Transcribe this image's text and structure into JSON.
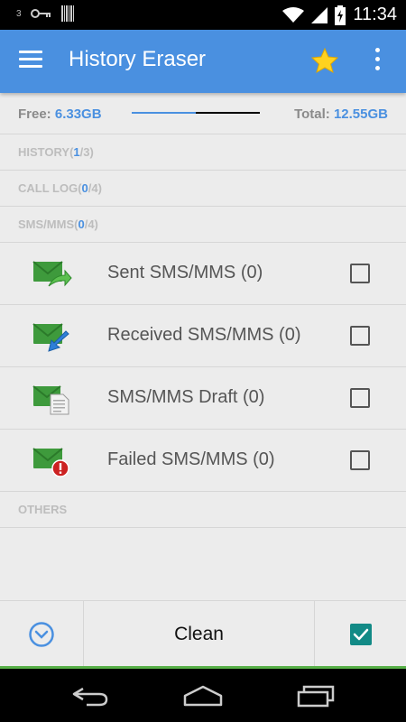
{
  "status_bar": {
    "time": "11:34",
    "left_icons": [
      "sim-3g-icon",
      "key-icon",
      "barcode-icon"
    ],
    "right_icons": [
      "wifi-icon",
      "signal-icon",
      "battery-charging-icon"
    ],
    "network_label": "3"
  },
  "app_bar": {
    "title": "History Eraser",
    "icons": [
      "hamburger-menu-icon",
      "star-icon",
      "overflow-menu-icon"
    ]
  },
  "storage": {
    "free_label": "Free:",
    "free_value": "6.33GB",
    "total_label": "Total:",
    "total_value": "12.55GB",
    "used_fraction": 0.5
  },
  "sections": {
    "history": {
      "name": "HISTORY",
      "open": "(",
      "selected": "1",
      "rest": "/3)"
    },
    "call_log": {
      "name": "CALL LOG",
      "open": "(",
      "selected": "0",
      "rest": "/4)"
    },
    "sms_mms": {
      "name": "SMS/MMS",
      "open": "(",
      "selected": "0",
      "rest": "/4)"
    },
    "others": {
      "name": "OTHERS"
    }
  },
  "sms_items": [
    {
      "label": "Sent SMS/MMS (0)",
      "icon": "sent-message-icon",
      "checked": false
    },
    {
      "label": "Received SMS/MMS (0)",
      "icon": "received-message-icon",
      "checked": false
    },
    {
      "label": "SMS/MMS Draft (0)",
      "icon": "draft-message-icon",
      "checked": false
    },
    {
      "label": "Failed SMS/MMS (0)",
      "icon": "failed-message-icon",
      "checked": false
    }
  ],
  "bottom_bar": {
    "clean_label": "Clean",
    "left_icon": "chevron-down-circle-icon",
    "right_icon": "select-all-checkbox-icon"
  },
  "nav_bar": {
    "icons": [
      "back-icon",
      "home-icon",
      "recent-apps-icon"
    ]
  },
  "colors": {
    "accent": "#4a90e0",
    "green": "#3e9a3c",
    "teal_check": "#128a86",
    "red": "#cc2222"
  }
}
